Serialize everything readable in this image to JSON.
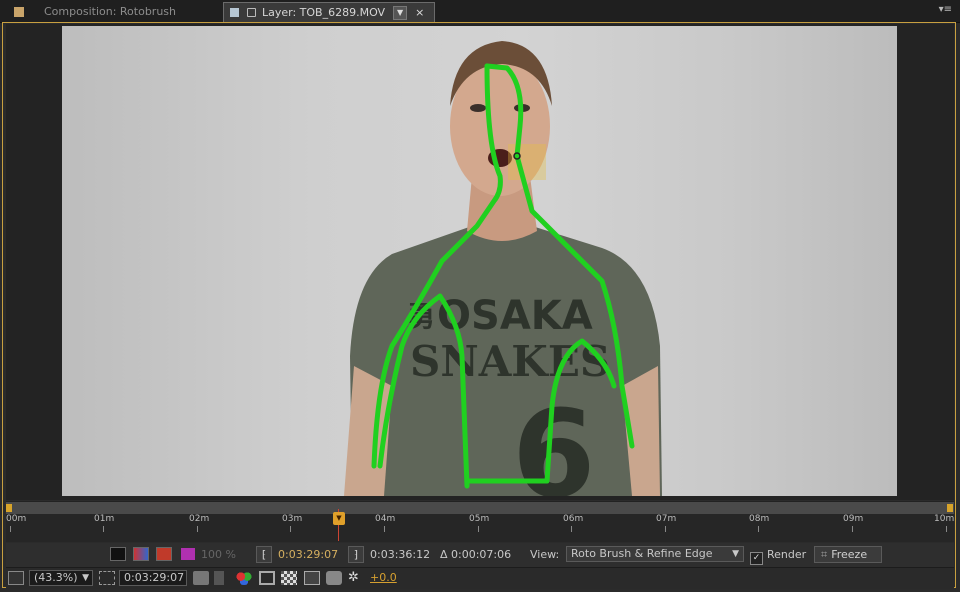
{
  "tabs": {
    "composition": "Composition: Rotobrush",
    "layer": "Layer: TOB_6289.MOV",
    "dropdown_glyph": "▼",
    "close_glyph": "×",
    "panel_menu_glyph": "▾≡"
  },
  "footage": {
    "shirt_line1": "OSAKA",
    "shirt_line2": "SNAKES",
    "shirt_number": "6",
    "kanji": "勇",
    "stroke_color": "#20d020"
  },
  "timeline": {
    "labels": [
      "00m",
      "01m",
      "02m",
      "03m",
      "04m",
      "05m",
      "06m",
      "07m",
      "08m",
      "09m",
      "10m"
    ],
    "playhead_color": "#e0a02a"
  },
  "controls": {
    "opacity_label": "100 %",
    "current_time": "0:03:29:07",
    "end_time": "0:03:36:12",
    "duration": "Δ 0:00:07:06",
    "view_label": "View:",
    "view_value": "Roto Brush & Refine Edge",
    "render_label": "Render",
    "freeze_label": "Freeze",
    "zoom_value": "(43.3%)",
    "status_time": "0:03:29:07",
    "exposure": "+0.0"
  }
}
